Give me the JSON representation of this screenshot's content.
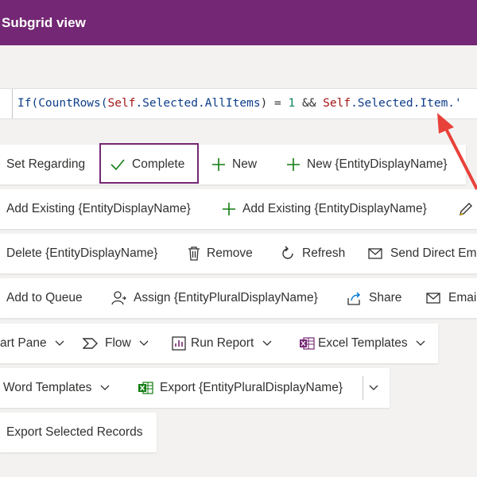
{
  "header": {
    "title": "Subgrid view"
  },
  "formula": {
    "parts": [
      {
        "t": "If(",
        "c": "fn"
      },
      {
        "t": "CountRows(",
        "c": "fn"
      },
      {
        "t": "Self",
        "c": "self"
      },
      {
        "t": ".Selected.AllItems",
        "c": "prop"
      },
      {
        "t": ") = ",
        "c": "op"
      },
      {
        "t": "1",
        "c": "num"
      },
      {
        "t": " && ",
        "c": "op"
      },
      {
        "t": "Self",
        "c": "self"
      },
      {
        "t": ".Selected.Item.'",
        "c": "prop"
      }
    ]
  },
  "rows": {
    "r1": {
      "set_regarding": "Set Regarding",
      "complete": "Complete",
      "new": "New",
      "new_entity": "New {EntityDisplayName}"
    },
    "r2": {
      "add_existing": "Add Existing {EntityDisplayName}",
      "add_existing_plus": "Add Existing {EntityDisplayName}"
    },
    "r3": {
      "delete": "Delete {EntityDisplayName}",
      "remove": "Remove",
      "refresh": "Refresh",
      "send_direct": "Send Direct Em"
    },
    "r4": {
      "add_queue": "Add to Queue",
      "assign": "Assign {EntityPluralDisplayName}",
      "share": "Share",
      "email": "Email"
    },
    "r5": {
      "chart_pane": "art Pane",
      "flow": "Flow",
      "run_report": "Run Report",
      "excel": "Excel Templates"
    },
    "r6": {
      "word": "Word Templates",
      "export": "Export {EntityPluralDisplayName}"
    },
    "r7": {
      "export_selected": "Export Selected Records"
    }
  },
  "colors": {
    "brand": "#742774",
    "accent_green": "#107c10",
    "arrow": "#e8413a"
  }
}
